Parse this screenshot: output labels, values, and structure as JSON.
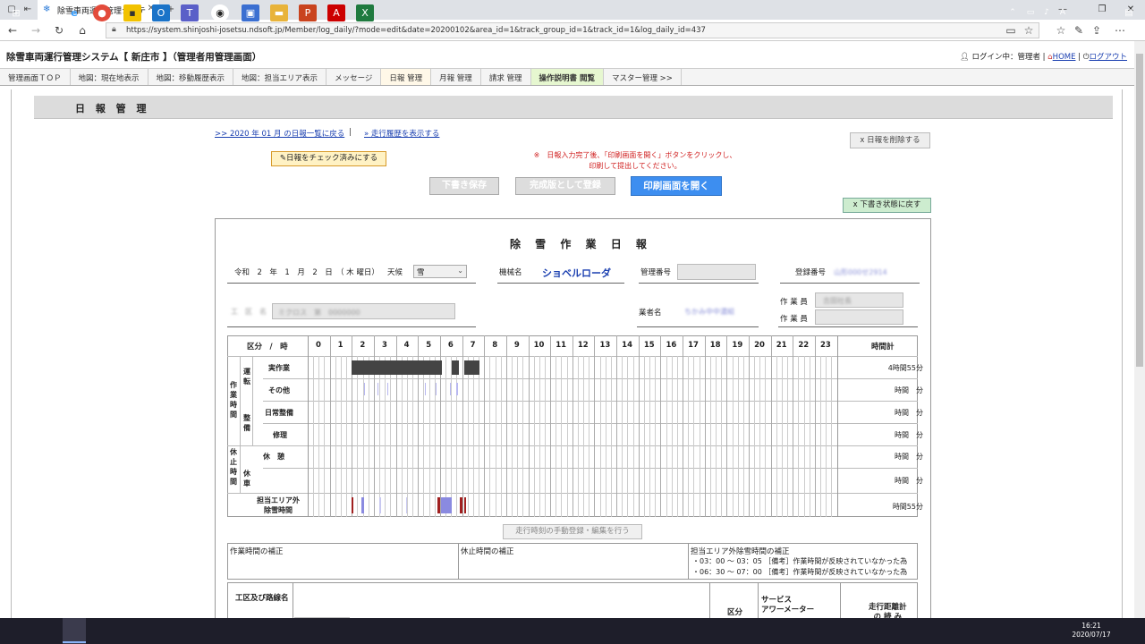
{
  "browser": {
    "tab_title": "除雪車両運行管理システ",
    "url": "https://system.shinjoshi-josetsu.ndsoft.jp/Member/log_daily/?mode=edit&date=20200102&area_id=1&track_group_id=1&track_id=1&log_daily_id=437"
  },
  "app": {
    "title": "除雪車両運行管理システム【 新庄市 】（管理者用管理画面）",
    "login": "ログイン中：管理者",
    "home": "HOME",
    "logout": "ログアウト"
  },
  "menu": [
    "管理画面ＴＯＰ",
    "地図：現在地表示",
    "地図：移動履歴表示",
    "地図：担当エリア表示",
    "メッセージ",
    "日報 管理",
    "月報 管理",
    "請求 管理",
    "操作説明書 閲覧",
    "マスター管理 >>"
  ],
  "page": {
    "heading": "日 報 管 理",
    "back_link": ">> 2020 年 01 月 の日報一覧に戻る",
    "separator": "|",
    "history_link": "» 走行履歴を表示する",
    "delete_button": "x 日報を削除する",
    "check_button": "日報をチェック済みにする",
    "notice_line1": "※　日報入力完了後、「印刷画面を開く」ボタンをクリックし、",
    "notice_line2": "印刷して提出してください。",
    "draft_save": "下書き保存",
    "final_register": "完成版として登録",
    "open_print": "印刷画面を開く",
    "revert_draft": "x 下書き状態に戻す"
  },
  "report": {
    "title": "除 雪 作 業 日 報",
    "date_text": "令和　2　年　1　月　2　日　（ 木 曜日）",
    "weather_label": "天候",
    "weather_value": "雪",
    "machine_label": "機械名",
    "machine_value": "ショベルローダ",
    "mgmt_label": "管理番号",
    "reg_label": "登録番号",
    "reg_value": "山形000せ2914",
    "route_label": "工　区　名",
    "route_value": "ミクロス　第　0000000",
    "vendor_label": "業者名",
    "vendor_value": "ちかみ中中濃組",
    "worker_label": "作 業 員",
    "worker_value": "吉田社長",
    "division_hour": "区分　/　時",
    "hours": [
      "0",
      "1",
      "2",
      "3",
      "4",
      "5",
      "6",
      "7",
      "8",
      "9",
      "10",
      "11",
      "12",
      "13",
      "14",
      "15",
      "16",
      "17",
      "18",
      "19",
      "20",
      "21",
      "22",
      "23"
    ],
    "total_label": "時間計",
    "cat_work": "作業時間",
    "cat_drive": "運転",
    "cat_maint": "整備",
    "cat_rest": "休止時間",
    "cat_stop": "休車",
    "rows": [
      {
        "label": "実作業",
        "total": "4時間55分"
      },
      {
        "label": "その他",
        "total": "時間　分"
      },
      {
        "label": "日常整備",
        "total": "時間　分"
      },
      {
        "label": "修理",
        "total": "時間　分"
      },
      {
        "label": "休　憩",
        "total": "時間　分"
      },
      {
        "label": "",
        "total": "時間　分"
      },
      {
        "label": "担当エリア外\n除雪時間",
        "total": "時間55分"
      }
    ],
    "manual_button": "走行時刻の手動登録・編集を行う",
    "work_correction": "作業時間の補正",
    "rest_correction": "休止時間の補正",
    "area_correction": "担当エリア外除雪時間の補正",
    "corr1": "・03：00 ～ 03：05 ［備考］作業時間が反映されていなかった為",
    "corr2": "・06：30 ～ 07：00 ［備考］作業時間が反映されていなかった為",
    "section_label": "工区及び路線名",
    "kubun": "区分",
    "service_meter": "サービス\nアワーメーター",
    "distance": "走行距離計\nの 読 み"
  },
  "clock": {
    "time": "16:21",
    "date": "2020/07/17"
  },
  "colors": {
    "accent": "#3d8ef0",
    "work_bar": "#444444",
    "area_red": "#a02020",
    "area_blue": "#8a8ae0"
  }
}
